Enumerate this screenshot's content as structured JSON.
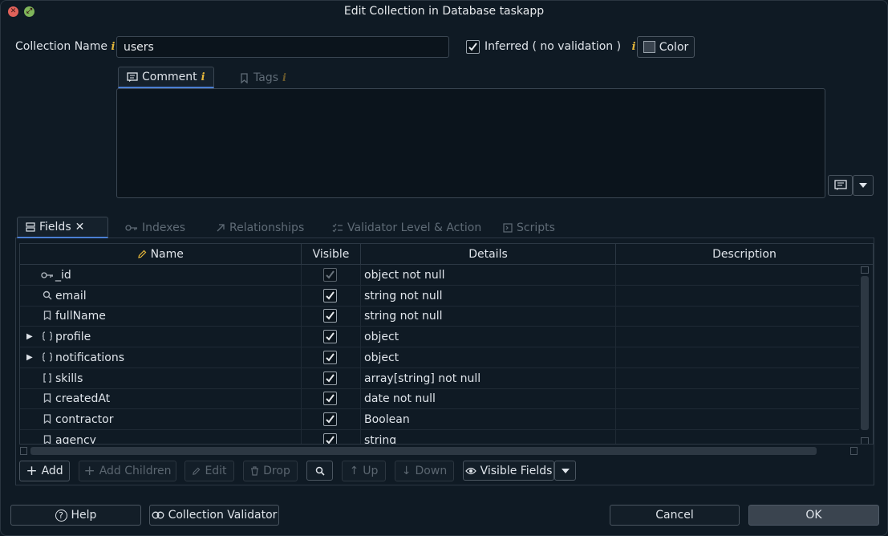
{
  "window": {
    "title": "Edit Collection in Database taskapp"
  },
  "form": {
    "collection_name_label": "Collection Name",
    "collection_name_value": "users",
    "inferred_label": "Inferred ( no validation )",
    "color_label": "Color"
  },
  "top_tabs": [
    {
      "label": "Comment"
    },
    {
      "label": "Tags"
    }
  ],
  "bottom_tabs": [
    {
      "label": "Fields"
    },
    {
      "label": "Indexes"
    },
    {
      "label": "Relationships"
    },
    {
      "label": "Validator Level & Action"
    },
    {
      "label": "Scripts"
    }
  ],
  "grid": {
    "columns": [
      "Name",
      "Visible",
      "Details",
      "Description"
    ],
    "rows": [
      {
        "name": "_id",
        "icon": "key-icon",
        "expandable": false,
        "visible": true,
        "visible_disabled": true,
        "details": "object not null",
        "description": ""
      },
      {
        "name": "email",
        "icon": "search-icon",
        "expandable": false,
        "visible": true,
        "visible_disabled": false,
        "details": "string not null",
        "description": ""
      },
      {
        "name": "fullName",
        "icon": "bookmark-icon",
        "expandable": false,
        "visible": true,
        "visible_disabled": false,
        "details": "string not null",
        "description": ""
      },
      {
        "name": "profile",
        "icon": "braces-icon",
        "expandable": true,
        "visible": true,
        "visible_disabled": false,
        "details": "object",
        "description": ""
      },
      {
        "name": "notifications",
        "icon": "braces-icon",
        "expandable": true,
        "visible": true,
        "visible_disabled": false,
        "details": "object",
        "description": ""
      },
      {
        "name": "skills",
        "icon": "brackets-icon",
        "expandable": false,
        "visible": true,
        "visible_disabled": false,
        "details": "array[string] not null",
        "description": ""
      },
      {
        "name": "createdAt",
        "icon": "bookmark-icon",
        "expandable": false,
        "visible": true,
        "visible_disabled": false,
        "details": "date not null",
        "description": ""
      },
      {
        "name": "contractor",
        "icon": "bookmark-icon",
        "expandable": false,
        "visible": true,
        "visible_disabled": false,
        "details": "Boolean",
        "description": ""
      },
      {
        "name": "agency",
        "icon": "bookmark-icon",
        "expandable": false,
        "visible": true,
        "visible_disabled": false,
        "details": "string",
        "description": ""
      }
    ]
  },
  "toolbar": {
    "add": "Add",
    "add_children": "Add Children",
    "edit": "Edit",
    "drop": "Drop",
    "up": "Up",
    "down": "Down",
    "visible_fields": "Visible Fields"
  },
  "footer": {
    "help": "Help",
    "collection_validator": "Collection Validator",
    "cancel": "Cancel",
    "ok": "OK"
  },
  "colors": {
    "background": "#0f1a24",
    "accent": "#4a7fd4",
    "info": "#e5b73b"
  }
}
